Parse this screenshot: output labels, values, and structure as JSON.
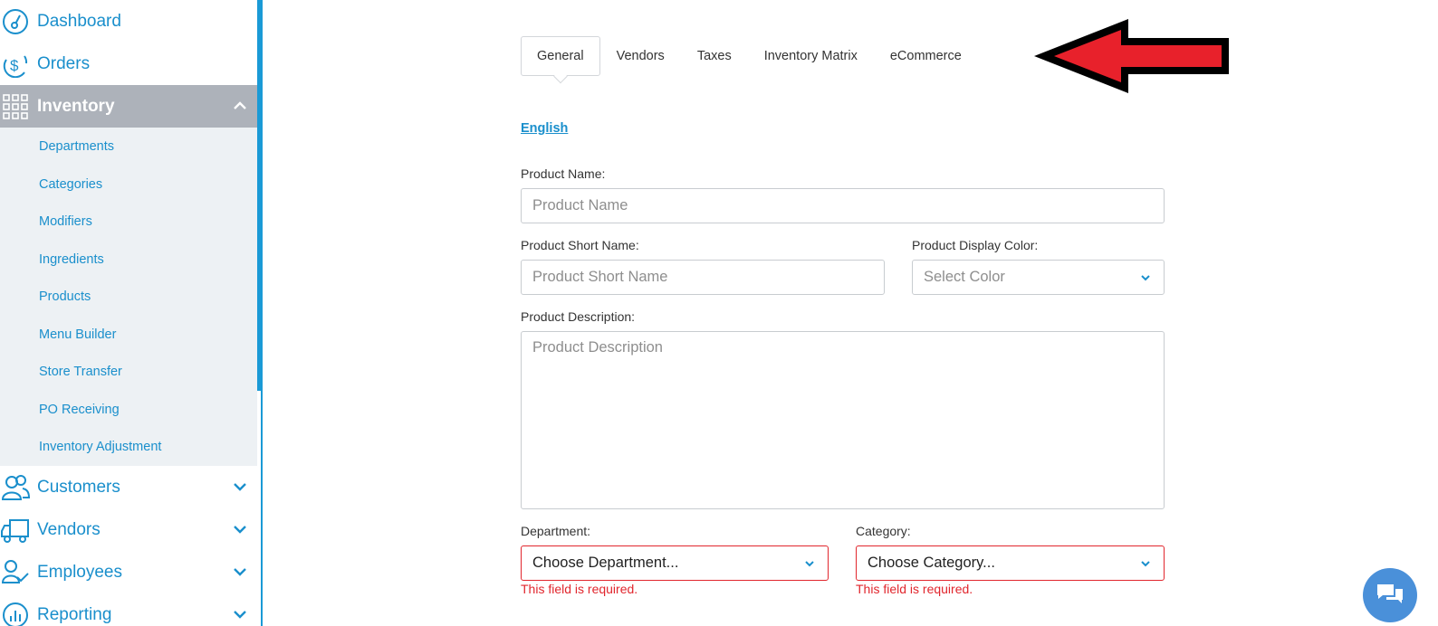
{
  "sidebar": {
    "items": [
      {
        "label": "Dashboard",
        "icon": "dashboard-gauge-icon"
      },
      {
        "label": "Orders",
        "icon": "dollar-refresh-icon"
      },
      {
        "label": "Inventory",
        "icon": "grid-icon",
        "expanded": true
      },
      {
        "label": "Customers",
        "icon": "users-icon"
      },
      {
        "label": "Vendors",
        "icon": "truck-icon"
      },
      {
        "label": "Employees",
        "icon": "employee-icon"
      },
      {
        "label": "Reporting",
        "icon": "chart-icon"
      }
    ],
    "inventory_sub": [
      "Departments",
      "Categories",
      "Modifiers",
      "Ingredients",
      "Products",
      "Menu Builder",
      "Store Transfer",
      "PO Receiving",
      "Inventory Adjustment"
    ]
  },
  "tabs": [
    "General",
    "Vendors",
    "Taxes",
    "Inventory Matrix",
    "eCommerce"
  ],
  "active_tab": "General",
  "language_link": "English",
  "form": {
    "product_name_label": "Product Name:",
    "product_name_placeholder": "Product Name",
    "short_name_label": "Product Short Name:",
    "short_name_placeholder": "Product Short Name",
    "display_color_label": "Product Display Color:",
    "display_color_value": "Select Color",
    "description_label": "Product Description:",
    "description_placeholder": "Product Description",
    "department_label": "Department:",
    "department_value": "Choose Department...",
    "category_label": "Category:",
    "category_value": "Choose Category...",
    "required_error": "This field is required."
  },
  "colors": {
    "accent": "#1a8fcc",
    "error": "#e1262d",
    "active_nav": "#adb2ba",
    "arrow_fill": "#e8212b"
  }
}
